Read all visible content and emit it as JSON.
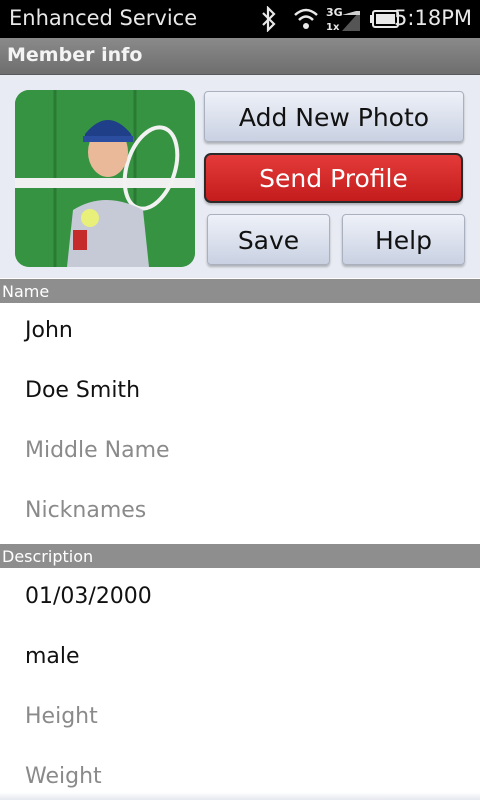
{
  "status_bar": {
    "title": "Enhanced Service",
    "time": "5:18PM",
    "network_label": "3G",
    "network_sub": "1x",
    "icons": [
      "bluetooth-icon",
      "wifi-icon",
      "signal-icon",
      "battery-icon"
    ]
  },
  "header": {
    "title": "Member info"
  },
  "buttons": {
    "add_photo": "Add New Photo",
    "send_profile": "Send Profile",
    "save": "Save",
    "help": "Help"
  },
  "sections": {
    "name": {
      "label": "Name",
      "first_name": "John",
      "last_name": "Doe Smith",
      "middle_name_placeholder": "Middle Name",
      "nicknames_placeholder": "Nicknames"
    },
    "description": {
      "label": "Description",
      "birth_date": "01/03/2000",
      "gender": "male",
      "height_placeholder": "Height",
      "weight_placeholder": "Weight"
    }
  },
  "colors": {
    "send_button": "#d42a2a",
    "panel_bg": "#e8ebf3",
    "section_header": "#8e8e8e"
  }
}
